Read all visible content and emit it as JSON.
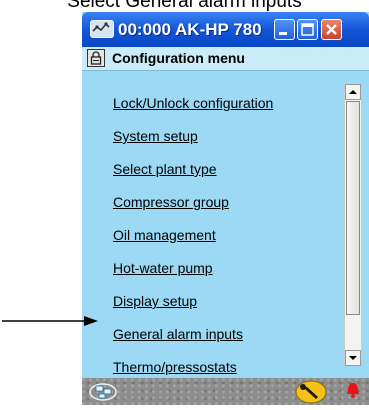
{
  "caption": "Select General alarm inputs",
  "window": {
    "title": "00:000 AK-HP 780",
    "icon": "network-icon",
    "controls": [
      "minimize",
      "maximize",
      "close"
    ]
  },
  "menu": {
    "header": "Configuration menu",
    "header_icon": "lock-icon",
    "items": [
      {
        "label": "Lock/Unlock configuration"
      },
      {
        "label": "System setup"
      },
      {
        "label": "Select plant type"
      },
      {
        "label": "Compressor group"
      },
      {
        "label": "Oil management"
      },
      {
        "label": "Hot-water pump"
      },
      {
        "label": "Display setup"
      },
      {
        "label": "General alarm inputs",
        "pointed": true
      },
      {
        "label": "Thermo/pressostats"
      }
    ]
  },
  "statusbar": {
    "icons": [
      "network-status-icon",
      "service-tool-icon",
      "alarm-bell-icon"
    ]
  },
  "colors": {
    "titlebar": "#1356d8",
    "background": "#9bd9f5",
    "close_button": "#c9442a",
    "alarm": "#e8141a"
  }
}
